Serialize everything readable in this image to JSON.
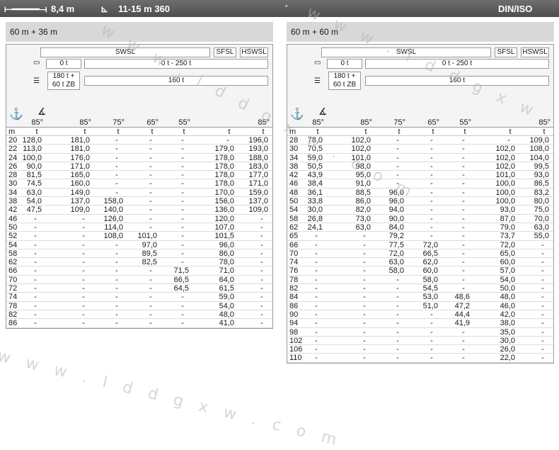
{
  "topbar": {
    "width": "8,4 m",
    "span": "11-15 m 360",
    "deg": "°",
    "norm": "DIN/ISO"
  },
  "panels": [
    {
      "boom": "60 m + 36 m",
      "swsl": "SWSL",
      "sfsl": "SFSL",
      "hswsl": "HSWSL",
      "cw_a1": "0 t",
      "cw_a2": "0 t - 250 t",
      "cw_b1": "180 t +\n60 t ZB",
      "cw_b2": "160 t",
      "angles": [
        "85°",
        "85°",
        "75°",
        "65°",
        "55°",
        "",
        "85°"
      ],
      "unit_m": "m",
      "units": [
        "t",
        "t",
        "t",
        "t",
        "t",
        "t",
        "t"
      ],
      "rows": [
        [
          "20",
          "128,0",
          "181,0",
          "-",
          "-",
          "-",
          "-",
          "196,0"
        ],
        [
          "22",
          "113,0",
          "181,0",
          "-",
          "-",
          "-",
          "179,0",
          "193,0"
        ],
        [
          "24",
          "100,0",
          "176,0",
          "-",
          "-",
          "-",
          "178,0",
          "188,0"
        ],
        [
          "26",
          "90,0",
          "171,0",
          "-",
          "-",
          "-",
          "178,0",
          "183,0"
        ],
        [
          "28",
          "81,5",
          "165,0",
          "-",
          "-",
          "-",
          "178,0",
          "177,0"
        ],
        [
          "30",
          "74,5",
          "160,0",
          "-",
          "-",
          "-",
          "178,0",
          "171,0"
        ],
        [
          "34",
          "63,0",
          "149,0",
          "-",
          "-",
          "-",
          "170,0",
          "159,0"
        ],
        [
          "38",
          "54,0",
          "137,0",
          "158,0",
          "-",
          "-",
          "156,0",
          "137,0"
        ],
        [
          "42",
          "47,5",
          "109,0",
          "140,0",
          "-",
          "-",
          "136,0",
          "109,0"
        ],
        [
          "46",
          "-",
          "-",
          "126,0",
          "-",
          "-",
          "120,0",
          "-"
        ],
        [
          "50",
          "-",
          "-",
          "114,0",
          "-",
          "-",
          "107,0",
          "-"
        ],
        [
          "52",
          "-",
          "-",
          "108,0",
          "101,0",
          "-",
          "101,5",
          "-"
        ],
        [
          "54",
          "-",
          "-",
          "-",
          "97,0",
          "-",
          "96,0",
          "-"
        ],
        [
          "58",
          "-",
          "-",
          "-",
          "89,5",
          "-",
          "86,0",
          "-"
        ],
        [
          "62",
          "-",
          "-",
          "-",
          "82,5",
          "-",
          "78,0",
          "-"
        ],
        [
          "66",
          "-",
          "-",
          "-",
          "-",
          "71,5",
          "71,0",
          "-"
        ],
        [
          "70",
          "-",
          "-",
          "-",
          "-",
          "66,5",
          "64,0",
          "-"
        ],
        [
          "72",
          "-",
          "-",
          "-",
          "-",
          "64,5",
          "61,5",
          "-"
        ],
        [
          "74",
          "-",
          "-",
          "-",
          "-",
          "-",
          "59,0",
          "-"
        ],
        [
          "78",
          "-",
          "-",
          "-",
          "-",
          "-",
          "54,0",
          "-"
        ],
        [
          "82",
          "-",
          "-",
          "-",
          "-",
          "-",
          "48,0",
          "-"
        ],
        [
          "86",
          "-",
          "-",
          "-",
          "-",
          "-",
          "41,0",
          "-"
        ]
      ]
    },
    {
      "boom": "60 m + 60 m",
      "swsl": "SWSL",
      "sfsl": "SFSL",
      "hswsl": "HSWSL",
      "cw_a1": "0 t",
      "cw_a2": "0 t - 250 t",
      "cw_b1": "180 t +\n60 t ZB",
      "cw_b2": "160 t",
      "angles": [
        "85°",
        "85°",
        "75°",
        "65°",
        "55°",
        "",
        "85°"
      ],
      "unit_m": "m",
      "units": [
        "t",
        "t",
        "t",
        "t",
        "t",
        "t",
        "t"
      ],
      "rows": [
        [
          "28",
          "78,0",
          "102,0",
          "-",
          "-",
          "-",
          "-",
          "109,0"
        ],
        [
          "30",
          "70,5",
          "102,0",
          "-",
          "-",
          "-",
          "102,0",
          "108,0"
        ],
        [
          "34",
          "59,0",
          "101,0",
          "-",
          "-",
          "-",
          "102,0",
          "104,0"
        ],
        [
          "38",
          "50,5",
          "98,0",
          "-",
          "-",
          "-",
          "102,0",
          "99,5"
        ],
        [
          "42",
          "43,9",
          "95,0",
          "-",
          "-",
          "-",
          "101,0",
          "93,0"
        ],
        [
          "46",
          "38,4",
          "91,0",
          "-",
          "-",
          "-",
          "100,0",
          "86,5"
        ],
        [
          "48",
          "36,1",
          "88,5",
          "96,0",
          "-",
          "-",
          "100,0",
          "83,2"
        ],
        [
          "50",
          "33,8",
          "86,0",
          "96,0",
          "-",
          "-",
          "100,0",
          "80,0"
        ],
        [
          "54",
          "30,0",
          "82,0",
          "94,0",
          "-",
          "-",
          "93,0",
          "75,0"
        ],
        [
          "58",
          "26,8",
          "73,0",
          "90,0",
          "-",
          "-",
          "87,0",
          "70,0"
        ],
        [
          "62",
          "24,1",
          "63,0",
          "84,0",
          "-",
          "-",
          "79,0",
          "63,0"
        ],
        [
          "65",
          "-",
          "-",
          "79,2",
          "-",
          "-",
          "73,7",
          "55,0"
        ],
        [
          "66",
          "-",
          "-",
          "77,5",
          "72,0",
          "-",
          "72,0",
          "-"
        ],
        [
          "70",
          "-",
          "-",
          "72,0",
          "66,5",
          "-",
          "65,0",
          "-"
        ],
        [
          "74",
          "-",
          "-",
          "63,0",
          "62,0",
          "-",
          "60,0",
          "-"
        ],
        [
          "76",
          "-",
          "-",
          "58,0",
          "60,0",
          "-",
          "57,0",
          "-"
        ],
        [
          "78",
          "-",
          "-",
          "-",
          "58,0",
          "-",
          "54,0",
          "-"
        ],
        [
          "82",
          "-",
          "-",
          "-",
          "54,5",
          "-",
          "50,0",
          "-"
        ],
        [
          "84",
          "-",
          "-",
          "-",
          "53,0",
          "48,6",
          "48,0",
          "-"
        ],
        [
          "86",
          "-",
          "-",
          "-",
          "51,0",
          "47,2",
          "46,0",
          "-"
        ],
        [
          "90",
          "-",
          "-",
          "-",
          "-",
          "44,4",
          "42,0",
          "-"
        ],
        [
          "94",
          "-",
          "-",
          "-",
          "-",
          "41,9",
          "38,0",
          "-"
        ],
        [
          "98",
          "-",
          "-",
          "-",
          "-",
          "-",
          "35,0",
          "-"
        ],
        [
          "102",
          "-",
          "-",
          "-",
          "-",
          "-",
          "30,0",
          "-"
        ],
        [
          "106",
          "-",
          "-",
          "-",
          "-",
          "-",
          "26,0",
          "-"
        ],
        [
          "110",
          "-",
          "-",
          "-",
          "-",
          "-",
          "22,0",
          "-"
        ]
      ]
    }
  ],
  "watermark": "w w w . l d d g x w . c o m"
}
